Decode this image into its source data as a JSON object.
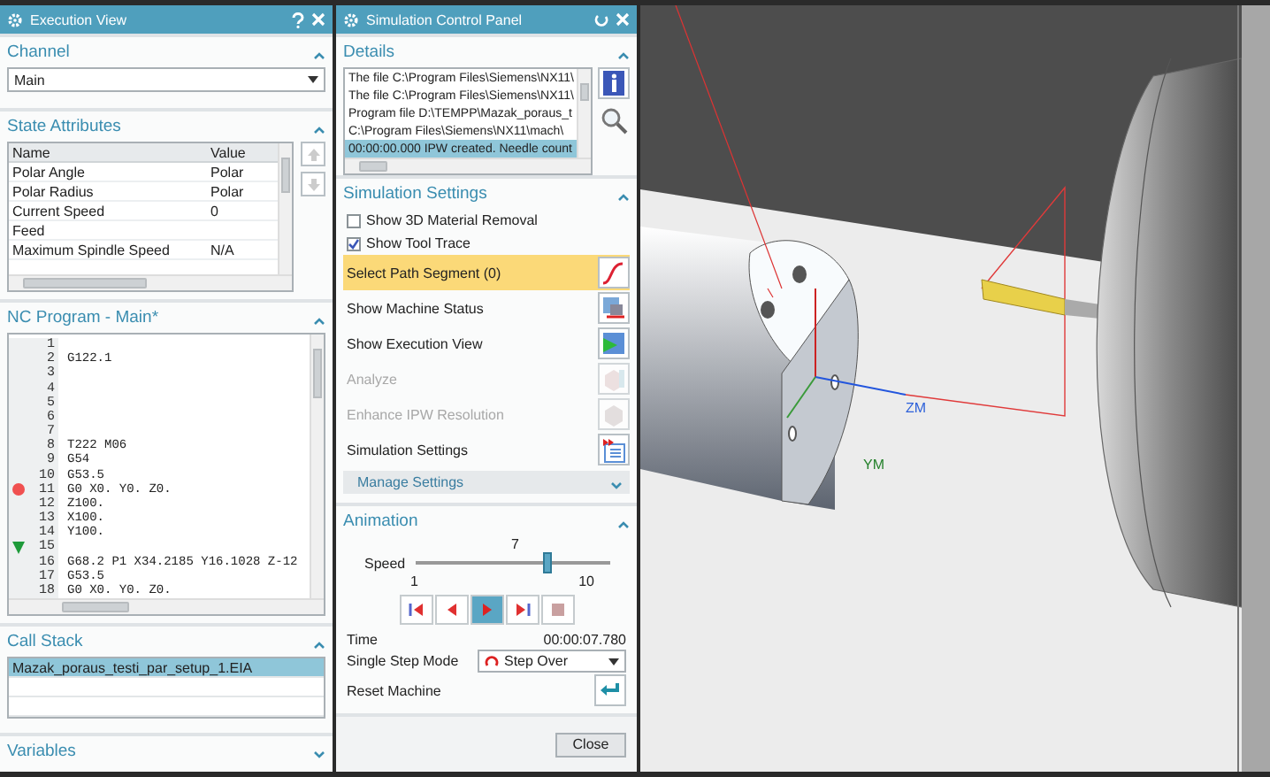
{
  "execution_view": {
    "title": "Execution View",
    "channel": {
      "title": "Channel",
      "expanded": true,
      "value": "Main"
    },
    "state_attributes": {
      "title": "State Attributes",
      "expanded": true,
      "columns": [
        "Name",
        "Value"
      ],
      "rows": [
        {
          "name": "Polar Angle",
          "value": "Polar"
        },
        {
          "name": "Polar Radius",
          "value": "Polar"
        },
        {
          "name": "Current Speed",
          "value": "0"
        },
        {
          "name": "Feed"
        },
        {
          "name": "Maximum Spindle Speed",
          "value": "N/A"
        }
      ]
    },
    "nc_program": {
      "title": "NC Program - Main*",
      "expanded": true,
      "lines": [
        {
          "number": "1",
          "breakpoint": false,
          "current": false
        },
        {
          "number": "2",
          "code": "G122.1",
          "breakpoint": false,
          "current": false
        },
        {
          "number": "3",
          "breakpoint": false,
          "current": false
        },
        {
          "number": "4",
          "breakpoint": false,
          "current": false
        },
        {
          "number": "5",
          "breakpoint": false,
          "current": false
        },
        {
          "number": "6",
          "breakpoint": false,
          "current": false
        },
        {
          "number": "7",
          "breakpoint": false,
          "current": false
        },
        {
          "number": "8",
          "code": "T222 M06",
          "breakpoint": false,
          "current": false
        },
        {
          "number": "9",
          "code": "G54",
          "breakpoint": false,
          "current": false
        },
        {
          "number": "10",
          "code": "G53.5",
          "breakpoint": false,
          "current": false
        },
        {
          "number": "11",
          "code": "G0 X0. Y0. Z0.",
          "breakpoint": true,
          "current": false
        },
        {
          "number": "12",
          "code": "Z100.",
          "breakpoint": false,
          "current": false
        },
        {
          "number": "13",
          "code": "X100.",
          "breakpoint": false,
          "current": false
        },
        {
          "number": "14",
          "code": "Y100.",
          "breakpoint": false,
          "current": false
        },
        {
          "number": "15",
          "breakpoint": false,
          "current": true
        },
        {
          "number": "16",
          "code": "G68.2 P1 X34.2185 Y16.1028 Z-12",
          "breakpoint": false,
          "current": false
        },
        {
          "number": "17",
          "code": "G53.5",
          "breakpoint": false,
          "current": false
        },
        {
          "number": "18",
          "code": "G0 X0. Y0. Z0.",
          "breakpoint": false,
          "current": false
        }
      ]
    },
    "call_stack": {
      "title": "Call Stack",
      "expanded": true,
      "rows": [
        {
          "text": "Mazak_poraus_testi_par_setup_1.EIA",
          "selected": true
        }
      ]
    },
    "variables": {
      "title": "Variables",
      "expanded": false
    }
  },
  "simulation_panel": {
    "title": "Simulation Control Panel",
    "details": {
      "title": "Details",
      "expanded": true,
      "lines": [
        {
          "text": "The file C:\\Program Files\\Siemens\\NX11\\",
          "selected": false
        },
        {
          "text": "The file C:\\Program Files\\Siemens\\NX11\\",
          "selected": false
        },
        {
          "text": "Program file D:\\TEMPP\\Mazak_poraus_t",
          "selected": false
        },
        {
          "text": "C:\\Program Files\\Siemens\\NX11\\mach\\",
          "selected": false
        },
        {
          "text": "00:00:00.000 IPW created. Needle count",
          "selected": true
        }
      ]
    },
    "simulation_settings": {
      "title": "Simulation Settings",
      "expanded": true,
      "checkboxes": [
        {
          "label": "Show 3D Material Removal",
          "checked": false
        },
        {
          "label": "Show Tool Trace",
          "checked": true
        }
      ],
      "actions": [
        {
          "label": "Select Path Segment (0)",
          "kind": "path",
          "selected": true,
          "disabled": false
        },
        {
          "label": "Show Machine Status",
          "kind": "status",
          "selected": false,
          "disabled": false
        },
        {
          "label": "Show Execution View",
          "kind": "execution",
          "selected": false,
          "disabled": false
        },
        {
          "label": "Analyze",
          "kind": "analyze",
          "selected": false,
          "disabled": true
        },
        {
          "label": "Enhance IPW Resolution",
          "kind": "ipw",
          "selected": false,
          "disabled": true
        },
        {
          "label": "Simulation Settings",
          "kind": "settings",
          "selected": false,
          "disabled": false
        }
      ],
      "manage_settings": {
        "label": "Manage Settings",
        "expanded": false
      }
    },
    "animation": {
      "title": "Animation",
      "expanded": true,
      "speed": {
        "label": "Speed",
        "value": "7",
        "min": "1",
        "max": "10",
        "level": 0.667
      },
      "controls": [
        {
          "kind": "first",
          "selected": false
        },
        {
          "kind": "back",
          "selected": false
        },
        {
          "kind": "play",
          "selected": true
        },
        {
          "kind": "forward",
          "selected": false
        },
        {
          "kind": "stop",
          "selected": false
        }
      ],
      "time": {
        "label": "Time",
        "value": "00:00:07.780"
      },
      "single_step_mode": {
        "label": "Single Step Mode",
        "value": "Step Over"
      },
      "reset_machine": {
        "label": "Reset Machine"
      }
    },
    "close_button": "Close"
  },
  "viewport": {
    "axis_labels": [
      {
        "text": "ZM",
        "color": "#2b5fd9"
      },
      {
        "text": "YM",
        "color": "#23802a"
      }
    ]
  }
}
